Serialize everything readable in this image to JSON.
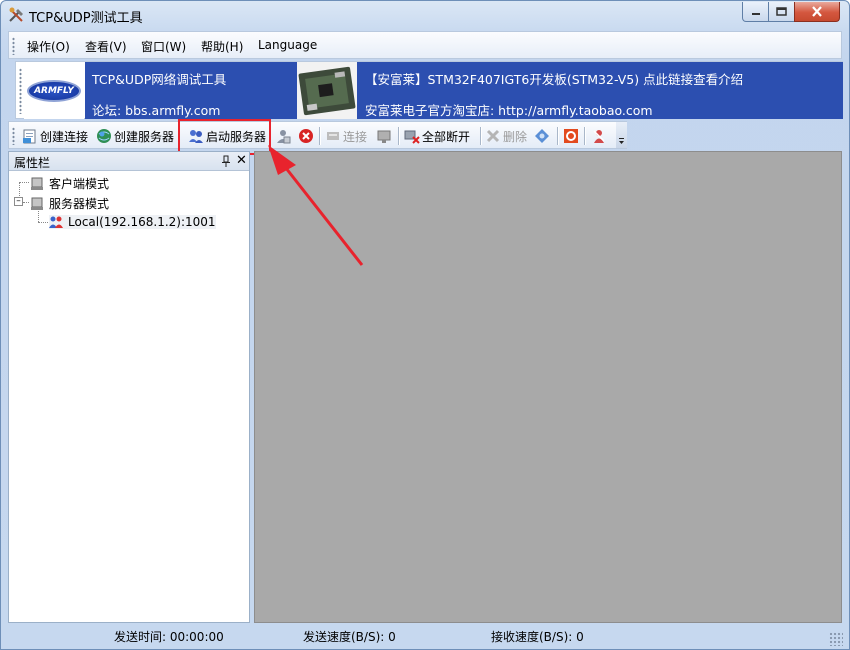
{
  "window": {
    "title": "TCP&UDP测试工具"
  },
  "menu": {
    "items": [
      {
        "label": "操作(O)"
      },
      {
        "label": "查看(V)"
      },
      {
        "label": "窗口(W)"
      },
      {
        "label": "帮助(H)"
      },
      {
        "label": "Language"
      }
    ]
  },
  "banner": {
    "logo_text": "ARMFLY",
    "left_line1": "TCP&UDP网络调试工具",
    "left_line2": "论坛: bbs.armfly.com",
    "right_line1": "【安富莱】STM32F407IGT6开发板(STM32-V5) 点此链接查看介绍",
    "right_line2": "安富莱电子官方淘宝店: http://armfly.taobao.com"
  },
  "toolbar": {
    "create_connection": "创建连接",
    "create_server": "创建服务器",
    "start_server": "启动服务器",
    "connect": "连接",
    "disconnect_all": "全部断开",
    "delete": "删除"
  },
  "panel": {
    "title": "属性栏",
    "tree": {
      "client_mode": "客户端模式",
      "server_mode": "服务器模式",
      "server_local": "Local(192.168.1.2):1001"
    }
  },
  "status": {
    "send_time": "发送时间: 00:00:00",
    "send_speed": "发送速度(B/S): 0",
    "recv_speed": "接收速度(B/S): 0"
  },
  "colors": {
    "banner_blue": "#2c4fb0",
    "content_gray": "#a9a9a9",
    "highlight_red": "#e8232d"
  }
}
